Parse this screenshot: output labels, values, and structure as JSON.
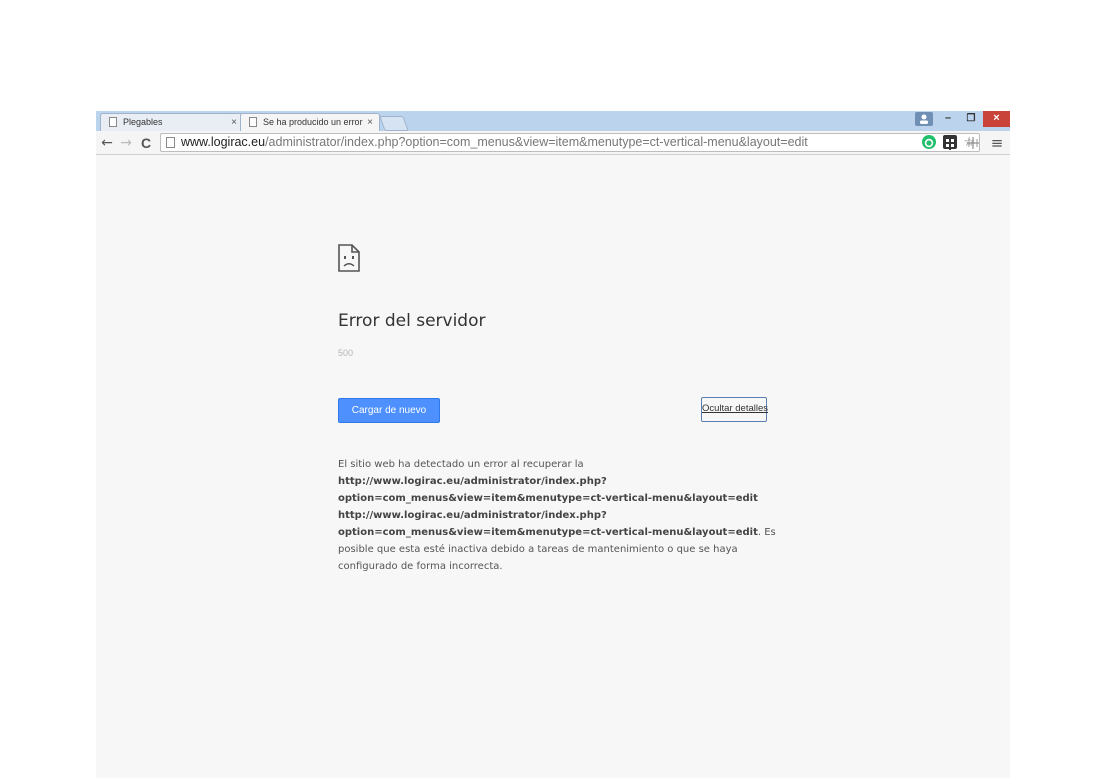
{
  "tabs": [
    {
      "title": "Plegables",
      "close": "×"
    },
    {
      "title": "Se ha producido un error",
      "close": "×"
    }
  ],
  "window_controls": {
    "minimize": "–",
    "maximize": "❐",
    "close": "×"
  },
  "nav": {
    "back": "←",
    "forward": "→",
    "reload": "C"
  },
  "address_bar": {
    "host": "www.logirac.eu",
    "path": "/administrator/index.php?option=com_menus&view=item&menutype=ct-vertical-menu&layout=edit"
  },
  "toolbar_icons": {
    "bookmark": "☆",
    "menu": "≡"
  },
  "error_page": {
    "title": "Error del servidor",
    "code": "500",
    "reload_button": "Cargar de nuevo",
    "details_button": "Ocultar detalles",
    "details_intro": "El sitio web ha detectado un error al recuperar la",
    "url_line1": "http://www.logirac.eu/administrator/index.php?",
    "url_line2": "option=com_menus&view=item&menutype=ct-vertical-menu&layout=edit",
    "url_line3": "http://www.logirac.eu/administrator/index.php?",
    "url_line4": "option=com_menus&view=item&menutype=ct-vertical-menu&layout=edit",
    "details_after_url": ". Es",
    "details_line5": "posible que esta esté inactiva debido a tareas de mantenimiento o que se haya",
    "details_line6": "configurado de forma incorrecta."
  },
  "colors": {
    "primary_button": "#4d90fe",
    "tab_strip": "#bcd3ee",
    "page_bg": "#f7f7f7"
  }
}
